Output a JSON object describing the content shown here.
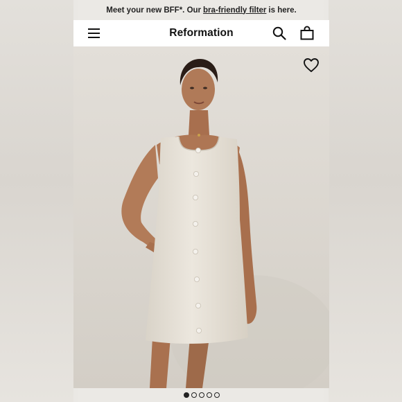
{
  "announcement": {
    "prefix": "Meet your new BFF*. Our",
    "link_text": "bra-friendly filter",
    "suffix": "is here."
  },
  "header": {
    "brand": "Reformation",
    "icons": [
      "menu-icon",
      "search-icon",
      "shopping-bag-icon"
    ]
  },
  "product": {
    "image_subject": "model wearing sleeveless button-front linen mini dress",
    "wishlist_icon": "heart-icon"
  },
  "carousel": {
    "total": 5,
    "active_index": 0
  },
  "colors": {
    "header_bg": "#ffffff",
    "text": "#111111",
    "photo_bg": "#dcd8d1",
    "dress": "#e9e4db",
    "skin": "#b07a58"
  }
}
